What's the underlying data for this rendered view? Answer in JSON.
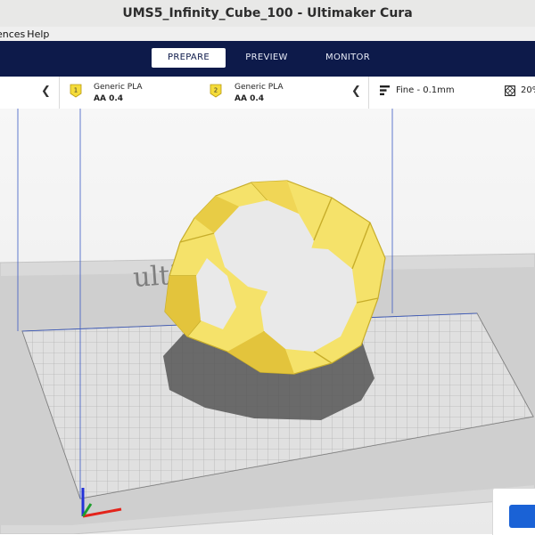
{
  "window": {
    "title": "UMS5_Infinity_Cube_100 - Ultimaker Cura"
  },
  "menubar": {
    "items": [
      "ences",
      "Help"
    ]
  },
  "nav": {
    "tabs": [
      {
        "label": "PREPARE",
        "active": true
      },
      {
        "label": "PREVIEW",
        "active": false
      },
      {
        "label": "MONITOR",
        "active": false
      }
    ]
  },
  "extruders": [
    {
      "index": "1",
      "material": "Generic PLA",
      "nozzle": "AA 0.4",
      "color": "#f5dc3a"
    },
    {
      "index": "2",
      "material": "Generic PLA",
      "nozzle": "AA 0.4",
      "color": "#f5dc3a"
    }
  ],
  "print_settings": {
    "quality": "Fine - 0.1mm",
    "infill": "20%"
  },
  "viewport": {
    "build_plate_logo": "ultima",
    "model_color": "#f5e26a",
    "axes": {
      "x_color": "#e3241b",
      "y_color": "#1f9e2e",
      "z_color": "#2432d8"
    }
  },
  "colors": {
    "nav_background": "#0d1a4a",
    "accent_blue": "#1a62d6"
  }
}
